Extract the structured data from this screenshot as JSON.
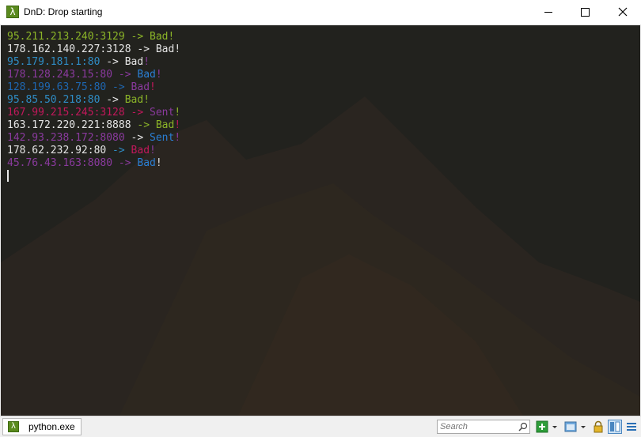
{
  "window": {
    "title": "DnD: Drop starting",
    "icon_glyph": "λ"
  },
  "console": {
    "lines": [
      {
        "segments": [
          {
            "text": "95.211.213.240:3129",
            "color": "#8bb428"
          },
          {
            "text": " -> ",
            "color": "#8bb428"
          },
          {
            "text": "Bad!",
            "color": "#8bb428"
          }
        ]
      },
      {
        "segments": [
          {
            "text": "178.162.140.227:3128",
            "color": "#e6e6e6"
          },
          {
            "text": " -> ",
            "color": "#e6e6e6"
          },
          {
            "text": "Bad!",
            "color": "#e6e6e6"
          }
        ]
      },
      {
        "segments": [
          {
            "text": "95.179.181.1:80",
            "color": "#2f8cc4"
          },
          {
            "text": " -> ",
            "color": "#e6e6e6"
          },
          {
            "text": "Bad",
            "color": "#e6e6e6"
          },
          {
            "text": "!",
            "color": "#8a3a9e"
          }
        ]
      },
      {
        "segments": [
          {
            "text": "178.128.243.15:80",
            "color": "#8a3a9e"
          },
          {
            "text": " -> ",
            "color": "#8a3a9e"
          },
          {
            "text": "Bad",
            "color": "#2a7fd4"
          },
          {
            "text": "!",
            "color": "#8a3a9e"
          }
        ]
      },
      {
        "segments": [
          {
            "text": "128.199.63.75:80",
            "color": "#1e66b0"
          },
          {
            "text": " -> ",
            "color": "#1e66b0"
          },
          {
            "text": "Bad",
            "color": "#8a3a9e"
          },
          {
            "text": "!",
            "color": "#c2185b"
          }
        ]
      },
      {
        "segments": [
          {
            "text": "95.85.50.218:80",
            "color": "#2f8cc4"
          },
          {
            "text": " -> ",
            "color": "#e6e6e6"
          },
          {
            "text": "Bad!",
            "color": "#8bb428"
          }
        ]
      },
      {
        "segments": [
          {
            "text": "167.99.215.245:3128",
            "color": "#c2185b"
          },
          {
            "text": " -> ",
            "color": "#c2185b"
          },
          {
            "text": "Sent",
            "color": "#8a3a9e"
          },
          {
            "text": "!",
            "color": "#8bb428"
          }
        ]
      },
      {
        "segments": [
          {
            "text": "163.172.220.221:8888",
            "color": "#e6e6e6"
          },
          {
            "text": " -> ",
            "color": "#8bb428"
          },
          {
            "text": "Bad",
            "color": "#8bb428"
          },
          {
            "text": "!",
            "color": "#c2185b"
          }
        ]
      },
      {
        "segments": [
          {
            "text": "142.93.238.172:8080",
            "color": "#8a3a9e"
          },
          {
            "text": " -> ",
            "color": "#e6e6e6"
          },
          {
            "text": "Sent",
            "color": "#2a7fd4"
          },
          {
            "text": "!",
            "color": "#8a3a9e"
          }
        ]
      },
      {
        "segments": [
          {
            "text": "178.62.232.92:80",
            "color": "#e6e6e6"
          },
          {
            "text": " -> ",
            "color": "#2f8cc4"
          },
          {
            "text": "Bad",
            "color": "#c2185b"
          },
          {
            "text": "!",
            "color": "#8a3a9e"
          }
        ]
      },
      {
        "segments": [
          {
            "text": "45.76.43.163:8080",
            "color": "#8a3a9e"
          },
          {
            "text": " -> ",
            "color": "#8a3a9e"
          },
          {
            "text": "Bad",
            "color": "#2a7fd4"
          },
          {
            "text": "!",
            "color": "#e6e6e6"
          }
        ]
      }
    ]
  },
  "taskbar": {
    "tab_label": "python.exe",
    "tab_icon_glyph": "λ"
  },
  "search": {
    "placeholder": "Search"
  },
  "status_icons": [
    {
      "name": "new-console-icon"
    },
    {
      "name": "dropdown-arrow-icon"
    },
    {
      "name": "console-view-icon"
    },
    {
      "name": "dropdown-arrow-icon"
    },
    {
      "name": "lock-icon"
    },
    {
      "name": "split-view-icon"
    },
    {
      "name": "menu-icon"
    }
  ],
  "colors": {
    "green": "#8bb428",
    "purple": "#8a3a9e",
    "blue": "#2a7fd4",
    "crimson": "#c2185b",
    "white": "#e6e6e6",
    "console_bg": "#22221e",
    "accent_green": "#5a8a1e"
  }
}
